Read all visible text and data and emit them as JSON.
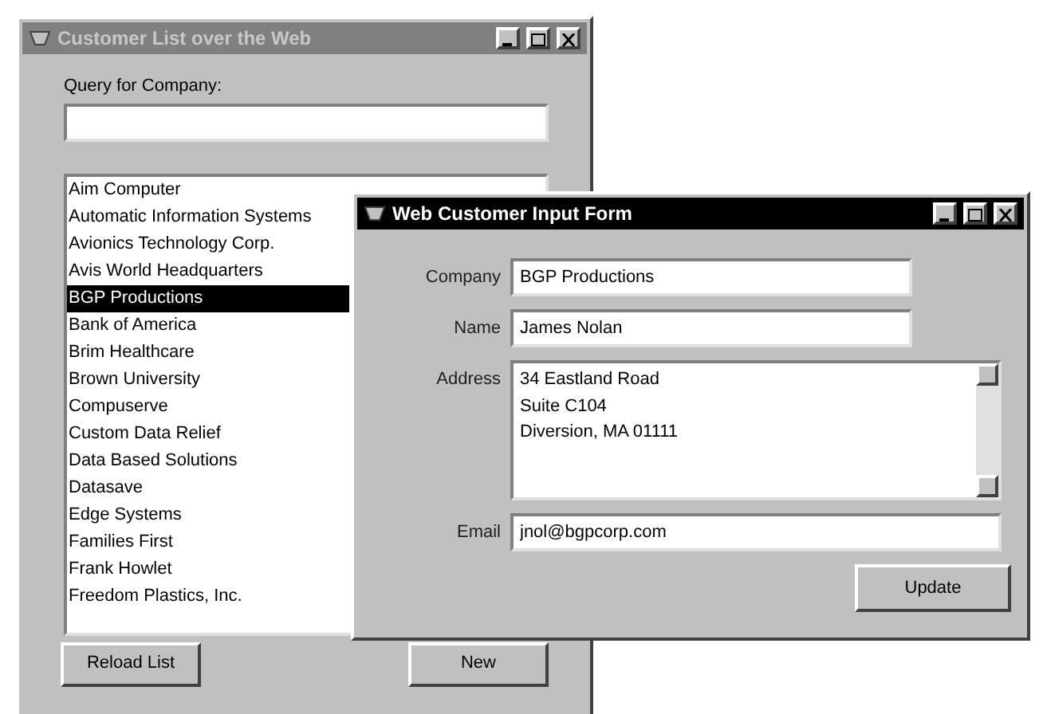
{
  "list_window": {
    "title": "Customer List over the Web",
    "active": false,
    "query": {
      "label": "Query for Company:"
    },
    "companies": [
      {
        "name": "Aim Computer",
        "selected": false
      },
      {
        "name": "Automatic Information Systems",
        "selected": false
      },
      {
        "name": "Avionics Technology Corp.",
        "selected": false
      },
      {
        "name": "Avis World Headquarters",
        "selected": false
      },
      {
        "name": "BGP Productions",
        "selected": true
      },
      {
        "name": "Bank of America",
        "selected": false
      },
      {
        "name": "Brim Healthcare",
        "selected": false
      },
      {
        "name": "Brown University",
        "selected": false
      },
      {
        "name": "Compuserve",
        "selected": false
      },
      {
        "name": "Custom Data Relief",
        "selected": false
      },
      {
        "name": "Data Based Solutions",
        "selected": false
      },
      {
        "name": "Datasave",
        "selected": false
      },
      {
        "name": "Edge Systems",
        "selected": false
      },
      {
        "name": "Families First",
        "selected": false
      },
      {
        "name": "Frank Howlet",
        "selected": false
      },
      {
        "name": "Freedom Plastics, Inc.",
        "selected": false
      }
    ],
    "buttons": [
      "Reload List",
      "New"
    ]
  },
  "form_window": {
    "title": "Web Customer Input Form",
    "active": true,
    "fields": [
      {
        "label": "Company",
        "value": "BGP Productions",
        "kind": "short"
      },
      {
        "label": "Name",
        "value": "James Nolan",
        "kind": "short"
      },
      {
        "label": "Address",
        "value": "34 Eastland Road\nSuite C104\nDiversion, MA  01111",
        "kind": "multiline"
      },
      {
        "label": "Email",
        "value": "jnol@bgpcorp.com",
        "kind": "wide"
      }
    ],
    "button": "Update"
  }
}
